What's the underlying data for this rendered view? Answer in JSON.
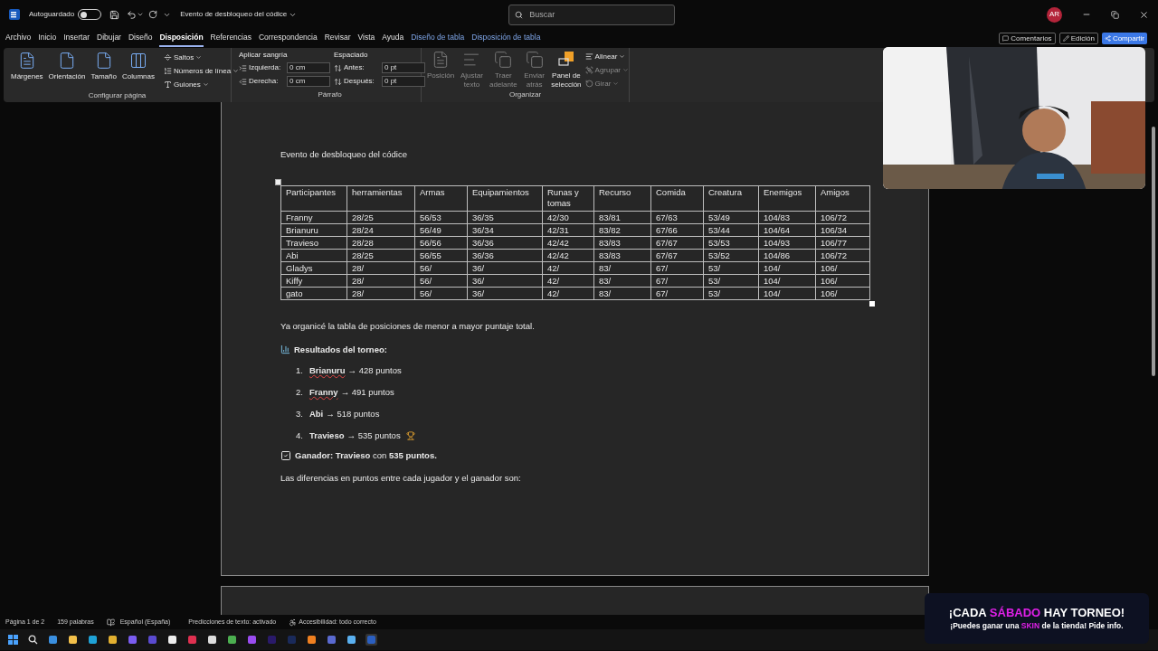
{
  "title_bar": {
    "autosave": {
      "label": "Autoguardado",
      "on": false
    },
    "document_title": "Evento de desbloqueo del códice",
    "search": {
      "placeholder": "Buscar"
    },
    "avatar": "AR"
  },
  "tabs": [
    {
      "label": "Archivo",
      "selected": false,
      "kind": "normal"
    },
    {
      "label": "Inicio",
      "selected": false,
      "kind": "normal"
    },
    {
      "label": "Insertar",
      "selected": false,
      "kind": "normal"
    },
    {
      "label": "Dibujar",
      "selected": false,
      "kind": "normal"
    },
    {
      "label": "Diseño",
      "selected": false,
      "kind": "normal"
    },
    {
      "label": "Disposición",
      "selected": true,
      "kind": "normal"
    },
    {
      "label": "Referencias",
      "selected": false,
      "kind": "normal"
    },
    {
      "label": "Correspondencia",
      "selected": false,
      "kind": "normal"
    },
    {
      "label": "Revisar",
      "selected": false,
      "kind": "normal"
    },
    {
      "label": "Vista",
      "selected": false,
      "kind": "normal"
    },
    {
      "label": "Ayuda",
      "selected": false,
      "kind": "normal"
    },
    {
      "label": "Diseño de tabla",
      "selected": false,
      "kind": "contextual"
    },
    {
      "label": "Disposición de tabla",
      "selected": false,
      "kind": "contextual"
    }
  ],
  "header_buttons": [
    {
      "label": "Comentarios",
      "kind": "comments"
    },
    {
      "label": "Edición",
      "kind": "editing"
    },
    {
      "label": "Compartir",
      "kind": "share"
    }
  ],
  "ribbon": {
    "page_setup": {
      "title": "Configurar página",
      "large": [
        {
          "label": "Márgenes"
        },
        {
          "label": "Orientación"
        },
        {
          "label": "Tamaño"
        },
        {
          "label": "Columnas"
        }
      ],
      "small": [
        {
          "label": "Saltos"
        },
        {
          "label": "Números de línea"
        },
        {
          "label": "Guiones"
        }
      ]
    },
    "paragraph": {
      "title": "Párrafo",
      "indent": {
        "title": "Aplicar sangría",
        "fields": [
          {
            "label": "Izquierda:",
            "value": "0 cm"
          },
          {
            "label": "Derecha:",
            "value": "0 cm"
          }
        ]
      },
      "spacing": {
        "title": "Espaciado",
        "fields": [
          {
            "label": "Antes:",
            "value": "0 pt"
          },
          {
            "label": "Después:",
            "value": "0 pt"
          }
        ]
      }
    },
    "arrange": {
      "title": "Organizar",
      "large": [
        {
          "label": "Posición",
          "disabled": true
        },
        {
          "label": "Ajustar texto",
          "disabled": true
        },
        {
          "label": "Traer adelante",
          "disabled": true
        },
        {
          "label": "Enviar atrás",
          "disabled": true
        },
        {
          "label": "Panel de selección",
          "disabled": false
        }
      ],
      "small": [
        {
          "label": "Alinear",
          "disabled": false
        },
        {
          "label": "Agrupar",
          "disabled": true
        },
        {
          "label": "Girar",
          "disabled": true
        }
      ]
    }
  },
  "document": {
    "heading": "Evento de desbloqueo del códice",
    "table": {
      "columns": [
        "Participantes",
        "herramientas",
        "Armas",
        "Equipamientos",
        "Runas y tomas",
        "Recurso",
        "Comida",
        "Creatura",
        "Enemigos",
        "Amigos"
      ],
      "rows": [
        [
          "Franny",
          "28/25",
          "56/53",
          "36/35",
          "42/30",
          "83/81",
          "67/63",
          "53/49",
          "104/83",
          "106/72"
        ],
        [
          "Brianuru",
          "28/24",
          "56/49",
          "36/34",
          "42/31",
          "83/82",
          "67/66",
          "53/44",
          "104/64",
          "106/34"
        ],
        [
          "Travieso",
          "28/28",
          "56/56",
          "36/36",
          "42/42",
          "83/83",
          "67/67",
          "53/53",
          "104/93",
          "106/77"
        ],
        [
          "Abi",
          "28/25",
          "56/55",
          "36/36",
          "42/42",
          "83/83",
          "67/67",
          "53/52",
          "104/86",
          "106/72"
        ],
        [
          "Gladys",
          "28/",
          "56/",
          "36/",
          "42/",
          "83/",
          "67/",
          "53/",
          "104/",
          "106/"
        ],
        [
          "Kiffy",
          "28/",
          "56/",
          "36/",
          "42/",
          "83/",
          "67/",
          "53/",
          "104/",
          "106/"
        ],
        [
          "gato",
          "28/",
          "56/",
          "36/",
          "42/",
          "83/",
          "67/",
          "53/",
          "104/",
          "106/"
        ]
      ]
    },
    "intro": "Ya organicé la tabla de posiciones de menor a mayor puntaje total.",
    "results_heading": "Resultados del torneo:",
    "results": [
      {
        "number": "1.",
        "name": "Brianuru",
        "rest": "→ 428 puntos",
        "spell_error": true,
        "trophy": false
      },
      {
        "number": "2.",
        "name": "Franny",
        "rest": "→ 491 puntos",
        "spell_error": true,
        "trophy": false
      },
      {
        "number": "3.",
        "name": "Abi",
        "rest": "→ 518 puntos",
        "spell_error": false,
        "trophy": false
      },
      {
        "number": "4.",
        "name": "Travieso",
        "rest": "→ 535 puntos",
        "spell_error": false,
        "trophy": true
      }
    ],
    "winner": "**Ganador: Travieso** con **535 puntos.**",
    "differences": "Las diferencias en puntos entre cada jugador y el ganador son:"
  },
  "status_bar": {
    "page": "Página 1 de 2",
    "words": "159 palabras",
    "language": "Español (España)",
    "predictions": "Predicciones de texto: activado",
    "accessibility": "Accesibilidad: todo correcto"
  },
  "banner": {
    "lines": [
      [
        {
          "text": "¡CADA ",
          "highlight": false
        },
        {
          "text": "SÁBADO",
          "highlight": true
        },
        {
          "text": " HAY TORNEO!",
          "highlight": false
        }
      ],
      [
        {
          "text": "¡Puedes ganar una ",
          "highlight": false
        },
        {
          "text": "SKIN",
          "highlight": true
        },
        {
          "text": " de la tienda! Pide info.",
          "highlight": false
        }
      ]
    ]
  }
}
